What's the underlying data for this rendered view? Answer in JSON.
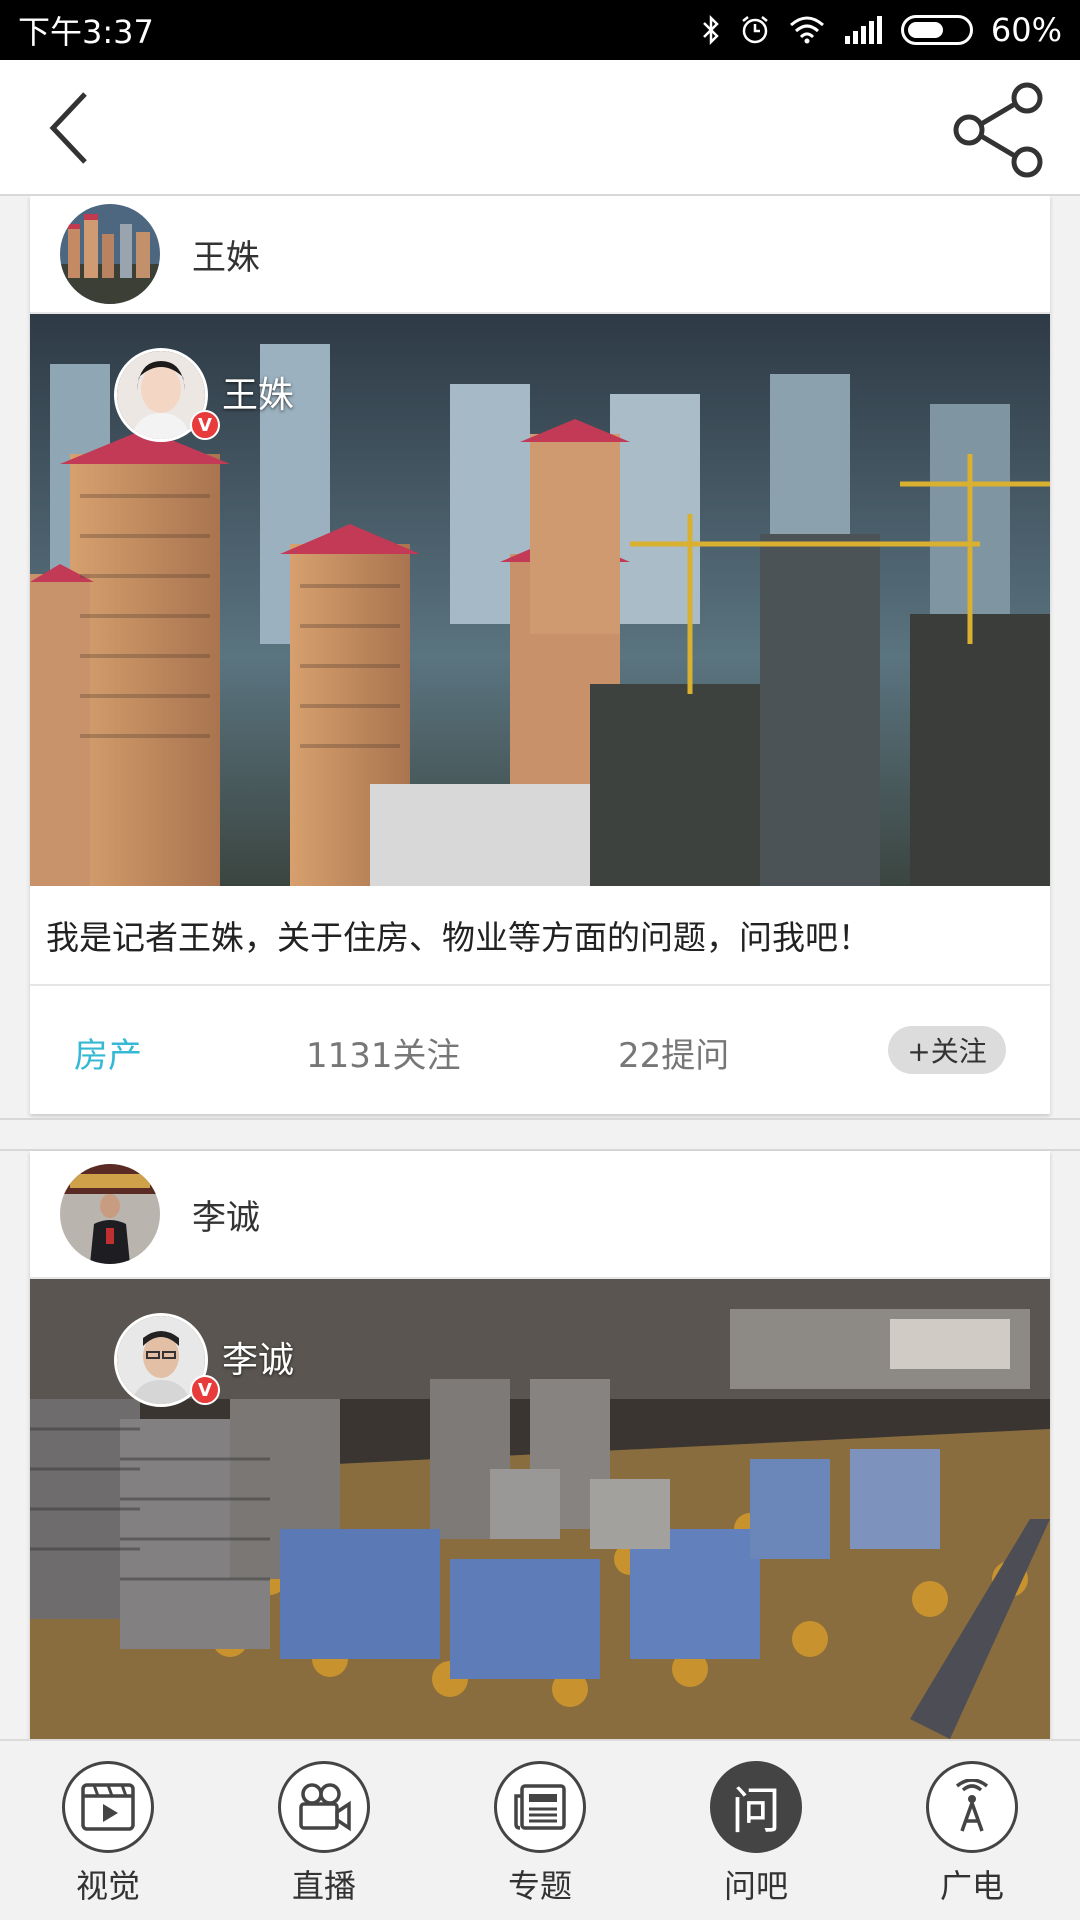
{
  "status": {
    "time": "下午3:37",
    "battery": "60%"
  },
  "cards": [
    {
      "author": "王姝",
      "overlay_name": "王姝",
      "badge": "V",
      "description": "我是记者王姝，关于住房、物业等方面的问题，问我吧！",
      "category": "房产",
      "followers": "1131关注",
      "questions": "22提问",
      "follow_label": "+关注"
    },
    {
      "author": "李诚",
      "overlay_name": "李诚",
      "badge": "V"
    }
  ],
  "tabs": [
    {
      "label": "视觉",
      "icon": "video-icon"
    },
    {
      "label": "直播",
      "icon": "camera-icon"
    },
    {
      "label": "专题",
      "icon": "newspaper-icon"
    },
    {
      "label": "问吧",
      "icon": "ask-icon",
      "active": true,
      "icon_text": "问"
    },
    {
      "label": "广电",
      "icon": "broadcast-tower-icon"
    }
  ]
}
